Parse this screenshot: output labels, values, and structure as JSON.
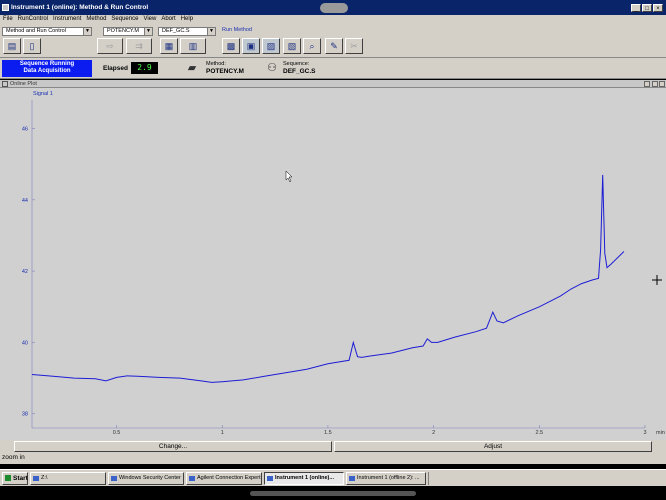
{
  "window": {
    "title": "Instrument 1 (online): Method & Run Control",
    "controls": [
      "_",
      "□",
      "×"
    ]
  },
  "menu": [
    "File",
    "RunControl",
    "Instrument",
    "Method",
    "Sequence",
    "View",
    "Abort",
    "Help"
  ],
  "toolbar": {
    "view_select": "Method and Run Control",
    "method_select": "POTENCY.M",
    "sequence_select": "DEF_GC.S",
    "run_method_label": "Run Method",
    "dropdown_arrow": "▼"
  },
  "status": {
    "sequence_line1": "Sequence Running",
    "sequence_line2": "Data Acquisition",
    "elapsed_label": "Elapsed",
    "elapsed_value": "2.9",
    "method_label": "Method:",
    "method_value": "POTENCY.M",
    "sequence_label": "Sequence:",
    "sequence_value": "DEF_GC.S"
  },
  "plot": {
    "window_title": "Online Plot",
    "signal_label": "Signal 1"
  },
  "chart_data": {
    "type": "line",
    "title": "",
    "xlabel": "min",
    "ylabel": "",
    "xlim": [
      0.1,
      3.0
    ],
    "ylim": [
      37.6,
      46.8
    ],
    "x_ticks": [
      0.5,
      1,
      1.5,
      2,
      2.5,
      3
    ],
    "x_tick_labels": [
      "0.5",
      "1",
      "1.5",
      "2",
      "2.5",
      "3"
    ],
    "y_ticks": [
      38,
      40,
      42,
      44,
      46
    ],
    "y_tick_labels": [
      "38",
      "40",
      "42",
      "44",
      "46"
    ],
    "grid": false,
    "series": [
      {
        "color": "#1c1cd6",
        "x": [
          0.1,
          0.2,
          0.3,
          0.4,
          0.45,
          0.5,
          0.55,
          0.6,
          0.7,
          0.8,
          0.9,
          0.95,
          1.0,
          1.1,
          1.2,
          1.3,
          1.4,
          1.5,
          1.55,
          1.6,
          1.62,
          1.64,
          1.66,
          1.7,
          1.8,
          1.9,
          1.95,
          1.97,
          1.99,
          2.02,
          2.1,
          2.2,
          2.25,
          2.28,
          2.3,
          2.33,
          2.4,
          2.5,
          2.6,
          2.65,
          2.7,
          2.75,
          2.78,
          2.79,
          2.8,
          2.81,
          2.82,
          2.84,
          2.9
        ],
        "y": [
          39.1,
          39.05,
          39.0,
          38.98,
          38.92,
          39.02,
          39.06,
          39.05,
          39.02,
          39.0,
          38.92,
          38.88,
          38.9,
          38.95,
          39.05,
          39.15,
          39.25,
          39.4,
          39.45,
          39.5,
          40.0,
          39.6,
          39.58,
          39.62,
          39.7,
          39.85,
          39.9,
          40.1,
          40.0,
          40.0,
          40.15,
          40.3,
          40.4,
          40.85,
          40.6,
          40.55,
          40.75,
          41.0,
          41.3,
          41.5,
          41.65,
          41.75,
          41.8,
          42.6,
          44.7,
          42.5,
          42.1,
          42.2,
          42.55
        ]
      }
    ]
  },
  "buttons": {
    "change": "Change...",
    "adjust": "Adjust"
  },
  "zoom_text": "zoom in",
  "taskbar": {
    "start": "Start",
    "items": [
      "Z:\\",
      "Windows Security Center",
      "Agilent Connection Expert",
      "Instrument 1 (online)...",
      "Instrument 1 (offline 2): ..."
    ]
  }
}
